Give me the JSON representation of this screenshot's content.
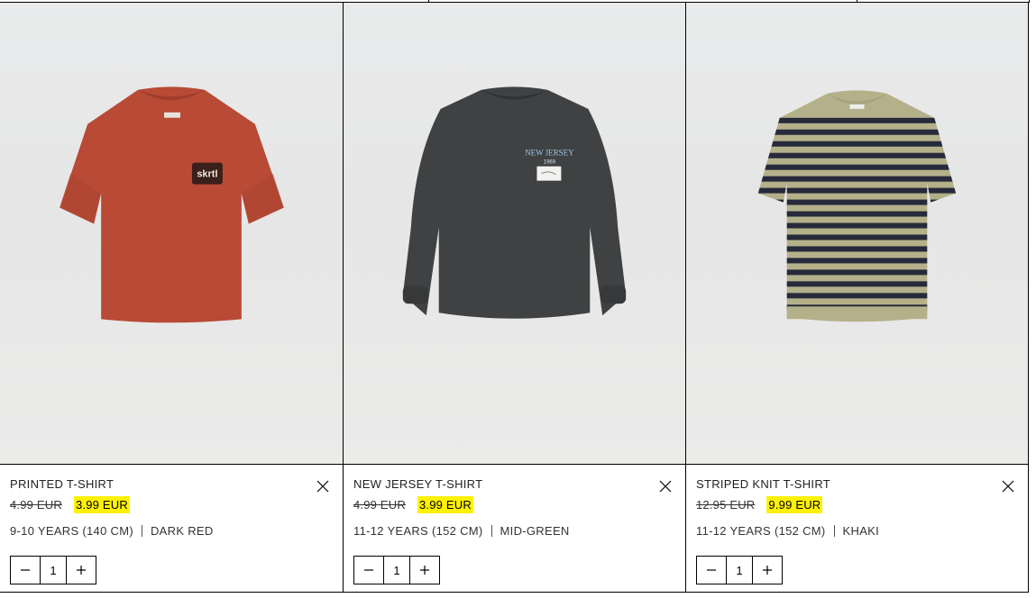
{
  "cart": {
    "items": [
      {
        "name": "PRINTED T-SHIRT",
        "old_price": "4.99 EUR",
        "new_price": "3.99 EUR",
        "size": "9-10 YEARS (140 CM)",
        "color": "DARK RED",
        "quantity": "1",
        "garment_color": "#b84a36",
        "print_text": "skrtl"
      },
      {
        "name": "NEW JERSEY T-SHIRT",
        "old_price": "4.99 EUR",
        "new_price": "3.99 EUR",
        "size": "11-12 YEARS (152 CM)",
        "color": "MID-GREEN",
        "quantity": "1",
        "garment_color": "#3f4142",
        "print_text": "NEW JERSEY",
        "print_year": "1969"
      },
      {
        "name": "STRIPED KNIT T-SHIRT",
        "old_price": "12.95 EUR",
        "new_price": "9.99 EUR",
        "size": "11-12 YEARS (152 CM)",
        "color": "KHAKI",
        "quantity": "1",
        "garment_color": "#b4b08a",
        "stripe_color": "#262a3a"
      }
    ],
    "icons": {
      "remove": "close-icon",
      "decrease": "minus-icon",
      "increase": "plus-icon"
    },
    "highlight_color": "#fff200"
  }
}
